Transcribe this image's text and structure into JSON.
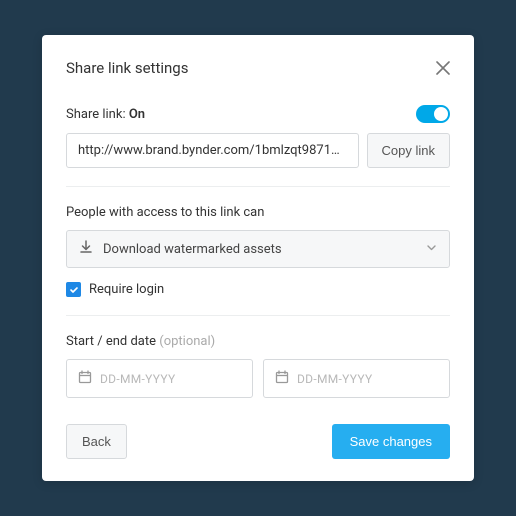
{
  "modal": {
    "title": "Share link settings",
    "shareLink": {
      "label": "Share link:",
      "statusText": "On",
      "url": "http://www.brand.bynder.com/1bmlzqt9871…",
      "copyLabel": "Copy link"
    },
    "access": {
      "label": "People with access to this link can",
      "selected": "Download watermarked assets"
    },
    "requireLogin": {
      "label": "Require login",
      "checked": true
    },
    "dates": {
      "label": "Start / end date",
      "optional": "(optional)",
      "startPlaceholder": "DD-MM-YYYY",
      "endPlaceholder": "DD-MM-YYYY"
    },
    "footer": {
      "back": "Back",
      "save": "Save changes"
    }
  }
}
